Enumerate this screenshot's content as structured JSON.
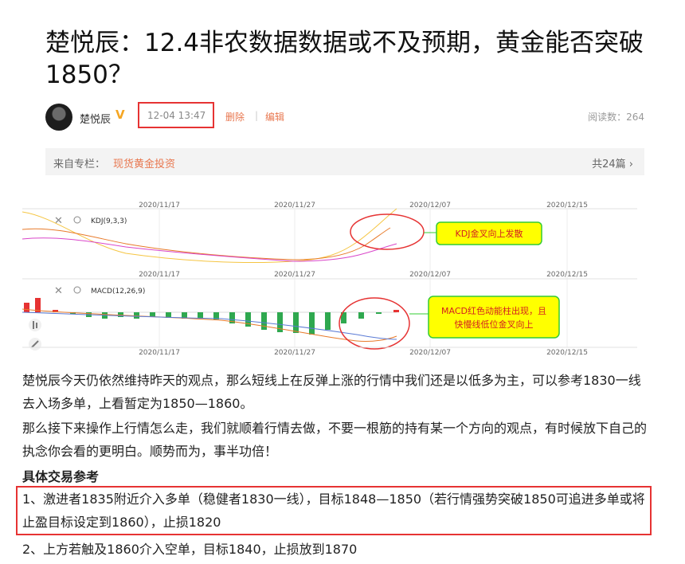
{
  "article": {
    "title": "楚悦辰：12.4非农数据数据或不及预期，黄金能否突破1850？",
    "author": "楚悦辰",
    "verified_badge": "V",
    "date": "12-04 13:47",
    "action_delete": "删除",
    "action_separator": "|",
    "action_edit": "编辑",
    "read_count": "阅读数：264"
  },
  "column": {
    "prefix": "来自专栏：",
    "name": "现货黄金投资",
    "count": "共24篇 ›"
  },
  "chart": {
    "date_labels": [
      "2020/11/17",
      "2020/11/27",
      "2020/12/07",
      "2020/12/15"
    ],
    "kdj_label": "KDJ(9,3,3)",
    "macd_label": "MACD(12,26,9)",
    "close_glyph": "✕",
    "annotation_kdj": "KDJ金叉向上发散",
    "annotation_macd_line1": "MACD红色动能柱出现，且",
    "annotation_macd_line2": "快慢线低位金叉向上",
    "accent_red": "#e63333",
    "annotation_fill": "#ffff00",
    "annotation_border": "#33cc33"
  },
  "chart_data": [
    {
      "type": "line",
      "title": "KDJ(9,3,3)",
      "x": [
        "2020/11/17",
        "2020/11/27",
        "2020/12/07",
        "2020/12/15"
      ]
    },
    {
      "type": "bar",
      "title": "MACD(12,26,9)",
      "x": [
        "2020/11/17",
        "2020/11/27",
        "2020/12/07",
        "2020/12/15"
      ]
    }
  ],
  "body": {
    "p1": "楚悦辰今天仍依然维持昨天的观点，那么短线上在反弹上涨的行情中我们还是以低多为主，可以参考1830一线去入场多单，上看暂定为1850—1860。",
    "p2": "那么接下来操作上行情怎么走，我们就顺着行情去做，不要一根筋的持有某一个方向的观点，有时候放下自己的执念你会看的更明白。顺势而为，事半功倍！",
    "subheading": "具体交易参考",
    "item1": "1、激进者1835附近介入多单（稳健者1830一线），目标1848—1850（若行情强势突破1850可追进多单或将止盈目标设定到1860），止损1820",
    "item2": "2、上方若触及1860介入空单，目标1840，止损放到1870"
  }
}
